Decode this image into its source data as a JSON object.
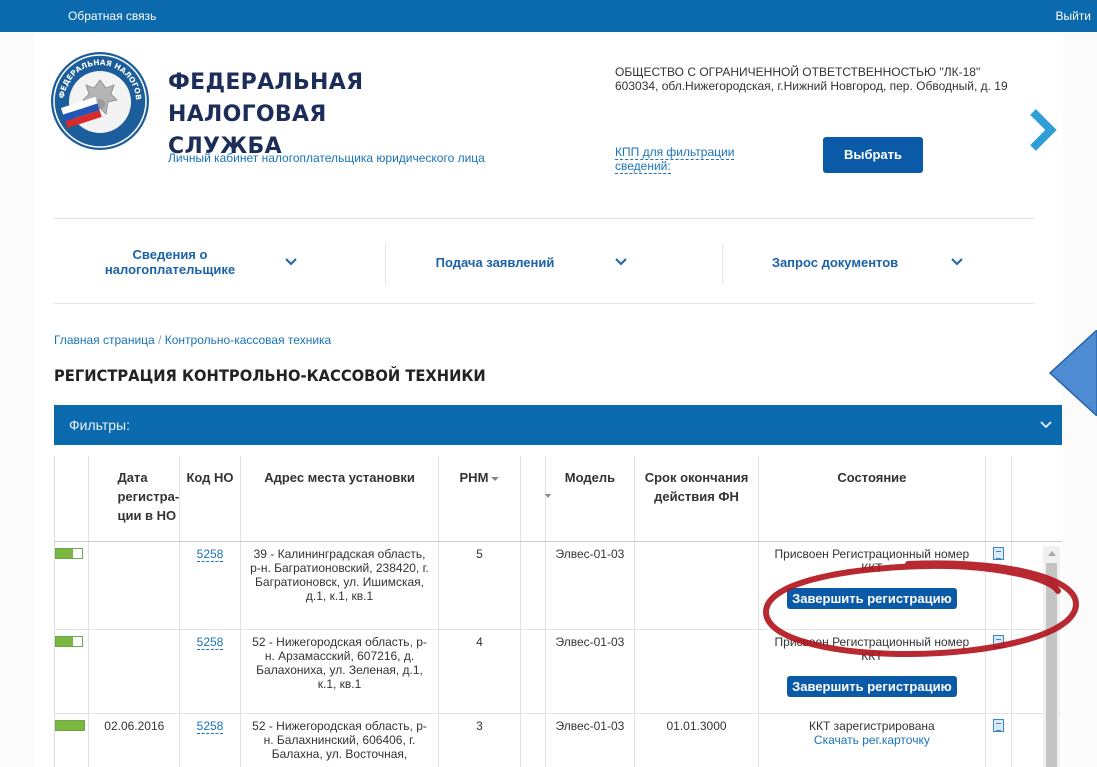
{
  "topbar": {
    "feedback": "Обратная связь",
    "logout": "Выйти"
  },
  "header": {
    "title_line1": "ФЕДЕРАЛЬНАЯ",
    "title_line2": "НАЛОГОВАЯ СЛУЖБА",
    "subtitle": "Личный кабинет налогоплательщика юридического лица",
    "logo_text": "ФЕДЕРАЛЬНАЯ НАЛОГОВАЯ СЛУЖБА"
  },
  "org": {
    "name": "ОБЩЕСТВО С ОГРАНИЧЕННОЙ ОТВЕТСТВЕННОСТЬЮ \"ЛК-18\"",
    "address": "603034, обл.Нижегородская, г.Нижний Новгород, пер. Обводный, д. 19",
    "kpp_label": "КПП для фильтрации сведений:",
    "select_button": "Выбрать"
  },
  "nav": [
    {
      "label": "Сведения о налогоплательщике"
    },
    {
      "label": "Подача заявлений"
    },
    {
      "label": "Запрос документов"
    }
  ],
  "breadcrumb": {
    "home": "Главная страница",
    "separator": "/",
    "current": "Контрольно-кассовая техника"
  },
  "page_title": "РЕГИСТРАЦИЯ КОНТРОЛЬНО-КАССОВОЙ ТЕХНИКИ",
  "filters": {
    "label": "Фильтры:"
  },
  "table": {
    "headers": {
      "date": "Дата регистра-ции в НО",
      "code": "Код НО",
      "address": "Адрес места установки",
      "rnm": "РНМ",
      "model": "Модель",
      "fn_expiry": "Срок окончания действия ФН",
      "status": "Состояние"
    },
    "rows": [
      {
        "indicator": "partial",
        "date": "",
        "code": "5258",
        "address": "39 - Калининградская область, р-н. Багратионовский, 238420, г. Багратионовск, ул. Ишимская, д.1, к.1, кв.1",
        "rnm": "5",
        "model": "Элвес-01-03",
        "fn_expiry": "",
        "status": "Присвоен Регистрационный номер ККТ",
        "action": "Завершить регистрацию"
      },
      {
        "indicator": "partial",
        "date": "",
        "code": "5258",
        "address": "52 - Нижегородская область, р-н. Арзамасский, 607216, д. Балахониха, ул. Зеленая, д.1, к.1, кв.1",
        "rnm": "4",
        "model": "Элвес-01-03",
        "fn_expiry": "",
        "status": "Присвоен Регистрационный номер ККТ",
        "action": "Завершить регистрацию"
      },
      {
        "indicator": "full",
        "date": "02.06.2016",
        "code": "5258",
        "address": "52 - Нижегородская область, р-н. Балахнинский, 606406, г. Балахна, ул. Восточная,",
        "rnm": "3",
        "model": "Элвес-01-03",
        "fn_expiry": "01.01.3000",
        "status": "ККТ зарегистрирована",
        "action_link": "Скачать рег.карточку"
      }
    ]
  },
  "colors": {
    "brand_blue": "#0b6aad",
    "button_blue": "#0b5aa7",
    "link_blue": "#1b73b9",
    "status_green": "#7cb83f",
    "annotation_red": "#b1121b"
  },
  "icons": [
    "chevron-right-icon",
    "chevron-down-icon",
    "arrow-left-icon",
    "document-icon",
    "sort-desc-icon",
    "filter-icon"
  ]
}
